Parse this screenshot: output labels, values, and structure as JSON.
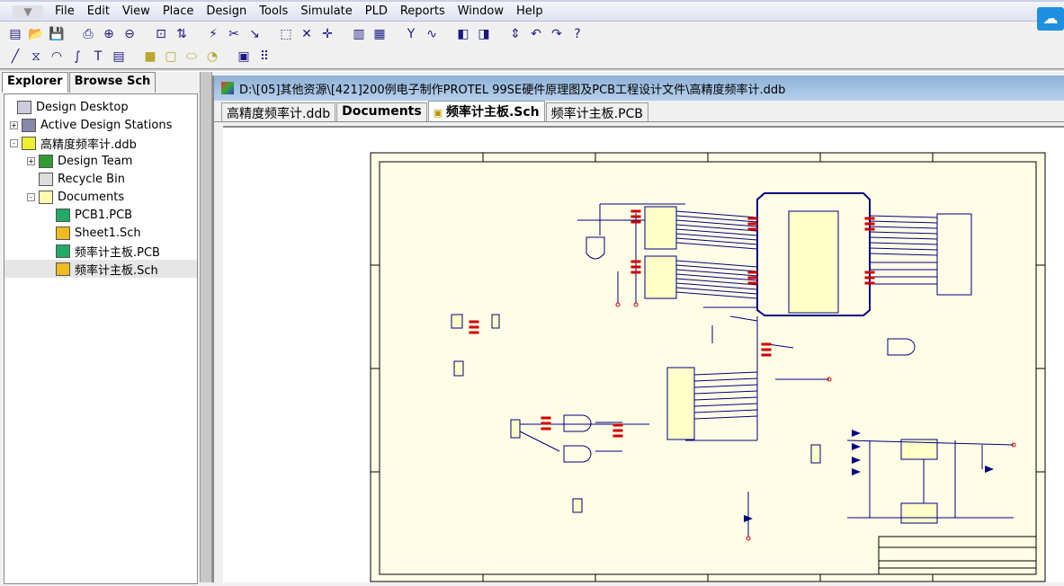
{
  "menubar": {
    "items": [
      "File",
      "Edit",
      "View",
      "Place",
      "Design",
      "Tools",
      "Simulate",
      "PLD",
      "Reports",
      "Window",
      "Help"
    ]
  },
  "toolbar1": [
    "design-manager",
    "open",
    "save",
    "print",
    "zoom-in",
    "zoom-out",
    "zoom-fit",
    "up-down-hierarchy",
    "cross-probe",
    "cut",
    "paste",
    "select",
    "deselect",
    "move",
    "browse-library",
    "add-library",
    "wiring-tools",
    "simulate",
    "component-wizard",
    "pld",
    "toggle",
    "undo",
    "redo",
    "help"
  ],
  "toolbar2": [
    "line",
    "polygon",
    "arc",
    "bezier",
    "text",
    "text-frame",
    "rectangle",
    "round-rectangle",
    "ellipse",
    "pie",
    "graphic",
    "array"
  ],
  "panel": {
    "tabs": [
      "Explorer",
      "Browse Sch"
    ],
    "tree": [
      {
        "label": "Design Desktop",
        "level": 0,
        "expander": "",
        "icon": "desktop"
      },
      {
        "label": "Active Design Stations",
        "level": 0,
        "expander": "+",
        "icon": "computer"
      },
      {
        "label": "高精度频率计.ddb",
        "level": 0,
        "expander": "-",
        "icon": "database"
      },
      {
        "label": "Design Team",
        "level": 1,
        "expander": "+",
        "icon": "team"
      },
      {
        "label": "Recycle Bin",
        "level": 1,
        "expander": "",
        "icon": "recycle-bin"
      },
      {
        "label": "Documents",
        "level": 1,
        "expander": "-",
        "icon": "folder"
      },
      {
        "label": "PCB1.PCB",
        "level": 2,
        "expander": "",
        "icon": "pcb"
      },
      {
        "label": "Sheet1.Sch",
        "level": 2,
        "expander": "",
        "icon": "sch"
      },
      {
        "label": "频率计主板.PCB",
        "level": 2,
        "expander": "",
        "icon": "pcb"
      },
      {
        "label": "频率计主板.Sch",
        "level": 2,
        "expander": "",
        "icon": "sch",
        "selected": true
      }
    ]
  },
  "document": {
    "title": "D:\\[05]其他资源\\[421]200例电子制作PROTEL 99SE硬件原理图及PCB工程设计文件\\高精度频率计.ddb",
    "tabs": [
      {
        "label": "高精度频率计.ddb",
        "bold": false
      },
      {
        "label": "Documents",
        "bold": true
      },
      {
        "label": "频率计主板.Sch",
        "bold": true,
        "active": true
      },
      {
        "label": "频率计主板.PCB",
        "bold": false
      }
    ]
  },
  "colors": {
    "wire": "#000080",
    "sheet": "#fffde6",
    "label": "#cc0000",
    "part": "#ffffc8"
  }
}
